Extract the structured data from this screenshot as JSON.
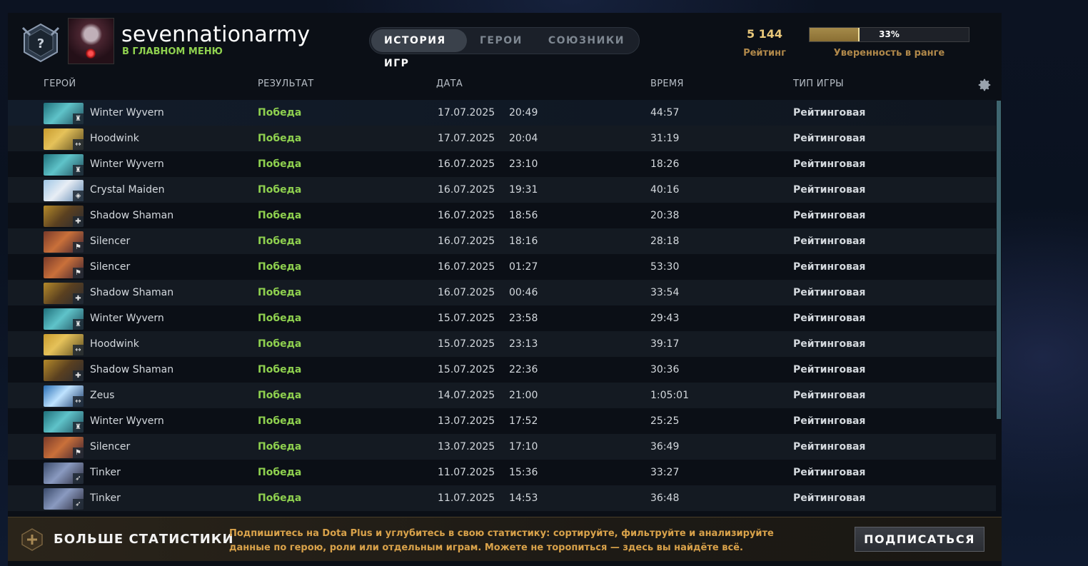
{
  "header": {
    "username": "sevennationarmy",
    "status": "В ГЛАВНОМ МЕНЮ",
    "tabs": [
      {
        "label": "ИСТОРИЯ ИГР",
        "active": true
      },
      {
        "label": "ГЕРОИ",
        "active": false
      },
      {
        "label": "СОЮЗНИКИ",
        "active": false
      }
    ],
    "rating_value": "5 144",
    "rating_label": "Рейтинг",
    "confidence_value": 0.33,
    "confidence_pct": "33%",
    "confidence_label": "Уверенность в ранге"
  },
  "columns": {
    "hero": "ГЕРОЙ",
    "result": "РЕЗУЛЬТАТ",
    "date": "ДАТА",
    "duration": "ВРЕМЯ",
    "type": "ТИП ИГРЫ"
  },
  "rows": [
    {
      "hero": "Winter Wyvern",
      "result": "Победа",
      "date": "17.07.2025",
      "time": "20:49",
      "duration": "44:57",
      "type": "Рейтинговая",
      "portrait": "wyvern",
      "role_icon": "tower-icon"
    },
    {
      "hero": "Hoodwink",
      "result": "Победа",
      "date": "17.07.2025",
      "time": "20:04",
      "duration": "31:19",
      "type": "Рейтинговая",
      "portrait": "hoodwink",
      "role_icon": "safelane-icon"
    },
    {
      "hero": "Winter Wyvern",
      "result": "Победа",
      "date": "16.07.2025",
      "time": "23:10",
      "duration": "18:26",
      "type": "Рейтинговая",
      "portrait": "wyvern",
      "role_icon": "tower-icon"
    },
    {
      "hero": "Crystal Maiden",
      "result": "Победа",
      "date": "16.07.2025",
      "time": "19:31",
      "duration": "40:16",
      "type": "Рейтинговая",
      "portrait": "maiden",
      "role_icon": "shield-icon"
    },
    {
      "hero": "Shadow Shaman",
      "result": "Победа",
      "date": "16.07.2025",
      "time": "18:56",
      "duration": "20:38",
      "type": "Рейтинговая",
      "portrait": "shaman",
      "role_icon": "support-icon"
    },
    {
      "hero": "Silencer",
      "result": "Победа",
      "date": "16.07.2025",
      "time": "18:16",
      "duration": "28:18",
      "type": "Рейтинговая",
      "portrait": "silencer",
      "role_icon": "flag-icon"
    },
    {
      "hero": "Silencer",
      "result": "Победа",
      "date": "16.07.2025",
      "time": "01:27",
      "duration": "53:30",
      "type": "Рейтинговая",
      "portrait": "silencer",
      "role_icon": "flag-icon"
    },
    {
      "hero": "Shadow Shaman",
      "result": "Победа",
      "date": "16.07.2025",
      "time": "00:46",
      "duration": "33:54",
      "type": "Рейтинговая",
      "portrait": "shaman",
      "role_icon": "support-icon"
    },
    {
      "hero": "Winter Wyvern",
      "result": "Победа",
      "date": "15.07.2025",
      "time": "23:58",
      "duration": "29:43",
      "type": "Рейтинговая",
      "portrait": "wyvern",
      "role_icon": "tower-icon"
    },
    {
      "hero": "Hoodwink",
      "result": "Победа",
      "date": "15.07.2025",
      "time": "23:13",
      "duration": "39:17",
      "type": "Рейтинговая",
      "portrait": "hoodwink",
      "role_icon": "safelane-icon"
    },
    {
      "hero": "Shadow Shaman",
      "result": "Победа",
      "date": "15.07.2025",
      "time": "22:36",
      "duration": "30:36",
      "type": "Рейтинговая",
      "portrait": "shaman",
      "role_icon": "support-icon"
    },
    {
      "hero": "Zeus",
      "result": "Победа",
      "date": "14.07.2025",
      "time": "21:00",
      "duration": "1:05:01",
      "type": "Рейтинговая",
      "portrait": "zeus",
      "role_icon": "safelane-icon"
    },
    {
      "hero": "Winter Wyvern",
      "result": "Победа",
      "date": "13.07.2025",
      "time": "17:52",
      "duration": "25:25",
      "type": "Рейтинговая",
      "portrait": "wyvern",
      "role_icon": "tower-icon"
    },
    {
      "hero": "Silencer",
      "result": "Победа",
      "date": "13.07.2025",
      "time": "17:10",
      "duration": "36:49",
      "type": "Рейтинговая",
      "portrait": "silencer",
      "role_icon": "flag-icon"
    },
    {
      "hero": "Tinker",
      "result": "Победа",
      "date": "11.07.2025",
      "time": "15:36",
      "duration": "33:27",
      "type": "Рейтинговая",
      "portrait": "tinker",
      "role_icon": "runner-icon"
    },
    {
      "hero": "Tinker",
      "result": "Победа",
      "date": "11.07.2025",
      "time": "14:53",
      "duration": "36:48",
      "type": "Рейтинговая",
      "portrait": "tinker",
      "role_icon": "runner-icon"
    }
  ],
  "footer": {
    "title": "БОЛЬШЕ СТАТИСТИКИ",
    "text": "Подпишитесь на Dota Plus и углубитесь в свою статистику: сортируйте, фильтруйте и анализируйте данные по герою, роли или отдельным играм. Можете не торопиться — здесь вы найдёте всё.",
    "button": "ПОДПИСАТЬСЯ"
  },
  "colors": {
    "win": "#8fd14f",
    "rating": "#e8c77a",
    "footer_text": "#d9a24a"
  }
}
